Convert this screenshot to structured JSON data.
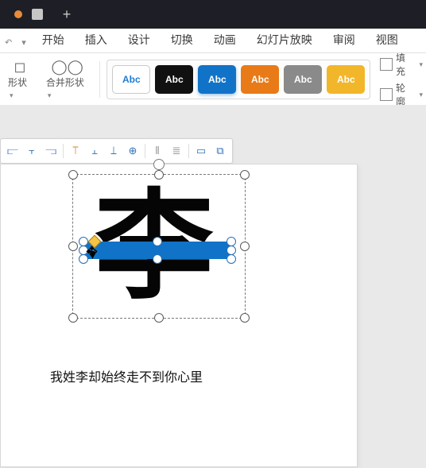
{
  "titlebar": {
    "new_tab_glyph": "+"
  },
  "menu": {
    "quick": {
      "undo_glyph": "↶",
      "drop_glyph": "▾"
    },
    "items": [
      {
        "label": "开始"
      },
      {
        "label": "插入"
      },
      {
        "label": "设计"
      },
      {
        "label": "切换"
      },
      {
        "label": "动画"
      },
      {
        "label": "幻灯片放映"
      },
      {
        "label": "审阅"
      },
      {
        "label": "视图"
      }
    ]
  },
  "ribbon": {
    "shape_btn": {
      "label": "形状",
      "caret": "▾"
    },
    "merge_btn": {
      "label": "合并形状",
      "caret": "▾",
      "glyph": "◯◯"
    },
    "chip_text": "Abc",
    "fill": {
      "label": "填充",
      "glyph": "◇",
      "caret": "▾"
    },
    "outline": {
      "label": "轮廓",
      "glyph": "▭",
      "caret": "▾"
    }
  },
  "float_toolbar": {
    "items": [
      {
        "glyph": "⫍",
        "name": "align-left"
      },
      {
        "glyph": "⫟",
        "name": "align-center-h"
      },
      {
        "glyph": "⫎",
        "name": "align-right"
      },
      {
        "glyph": "⟙",
        "name": "align-top",
        "cls": "ft-orange"
      },
      {
        "glyph": "⫠",
        "name": "align-middle-v"
      },
      {
        "glyph": "⟘",
        "name": "align-bottom"
      },
      {
        "glyph": "⊕",
        "name": "align-center-both"
      },
      {
        "glyph": "⫴",
        "name": "distribute-h",
        "cls": "ft-gray"
      },
      {
        "glyph": "≣",
        "name": "distribute-v",
        "cls": "ft-gray"
      },
      {
        "glyph": "▭",
        "name": "fit-slide"
      },
      {
        "glyph": "⧉",
        "name": "group"
      }
    ]
  },
  "slide": {
    "big_char": "李",
    "caption": "我姓李却始终走不到你心里"
  },
  "colors": {
    "accent_blue": "#1173c7",
    "accent_orange": "#e87a18",
    "accent_gold": "#f2b62a",
    "accent_gray": "#8a8a8a"
  }
}
